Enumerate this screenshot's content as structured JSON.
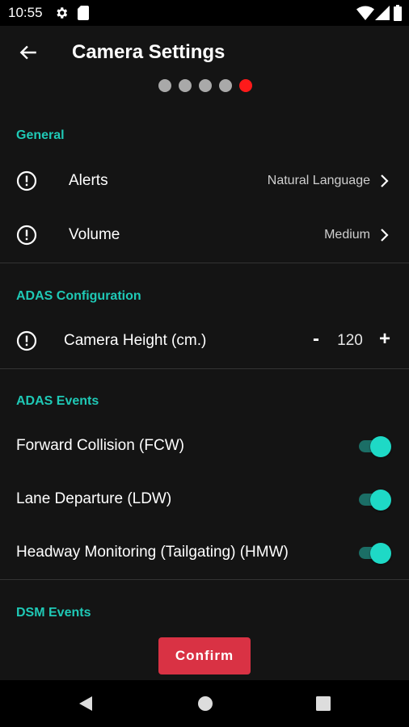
{
  "status_bar": {
    "time": "10:55",
    "icons": [
      "settings-gear-icon",
      "sim-card-icon",
      "wifi-icon",
      "cellular-signal-icon",
      "battery-icon"
    ]
  },
  "header": {
    "title": "Camera Settings",
    "back_icon": "arrow-left-icon",
    "steps_total": 5,
    "current_step": 5
  },
  "sections": {
    "general": {
      "title": "General",
      "alerts": {
        "label": "Alerts",
        "value": "Natural Language",
        "icon": "info-circle-icon"
      },
      "volume": {
        "label": "Volume",
        "value": "Medium",
        "icon": "info-circle-icon"
      }
    },
    "adas_config": {
      "title": "ADAS Configuration",
      "camera_height": {
        "label": "Camera Height (cm.)",
        "value": "120",
        "minus": "-",
        "plus": "+"
      }
    },
    "adas_events": {
      "title": "ADAS Events",
      "items": [
        {
          "label": "Forward Collision (FCW)",
          "enabled": true
        },
        {
          "label": "Lane Departure (LDW)",
          "enabled": true
        },
        {
          "label": "Headway Monitoring (Tailgating) (HMW)",
          "enabled": true
        }
      ]
    },
    "dsm_events": {
      "title": "DSM Events"
    }
  },
  "confirm_label": "Confirm",
  "colors": {
    "accent": "#1fc9b6",
    "toggle_on": "#1ed9c6",
    "confirm": "#d93244",
    "active_step": "#ff1a1a"
  }
}
